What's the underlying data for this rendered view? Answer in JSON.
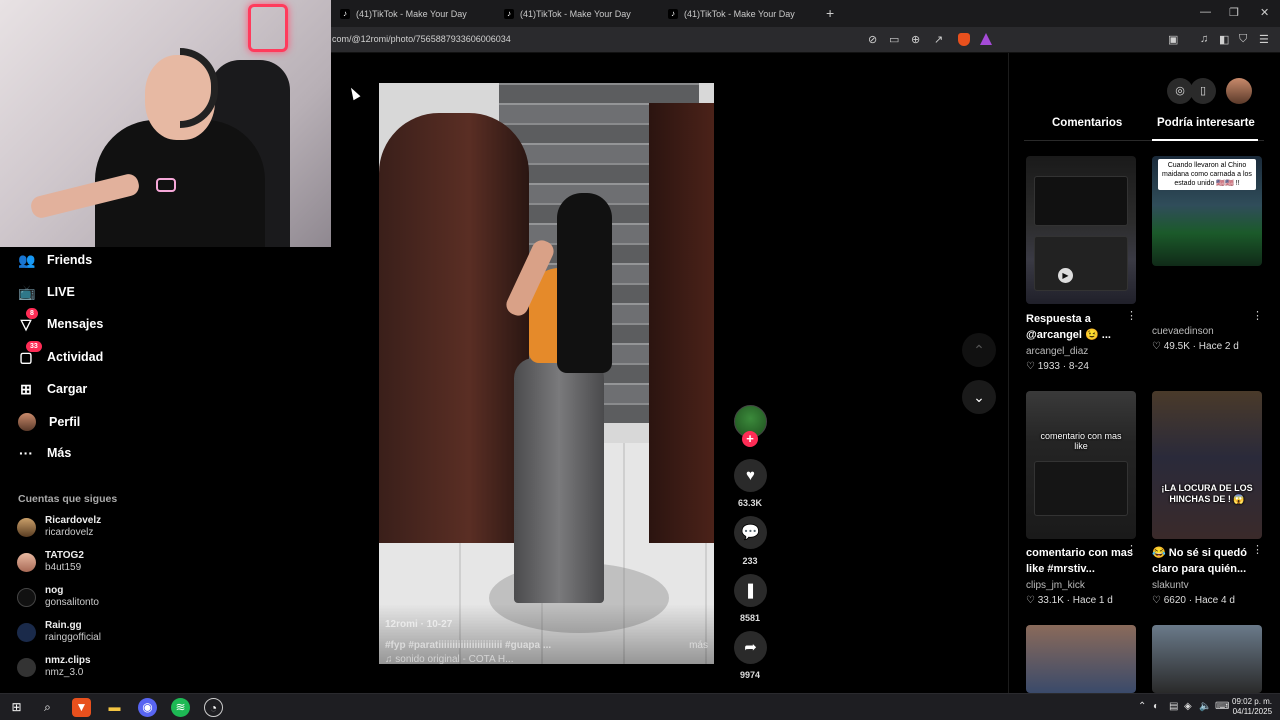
{
  "browser": {
    "tabs": [
      "(41)TikTok - Make Your Day",
      "(41)TikTok - Make Your Day",
      "(41)TikTok - Make Your Day"
    ],
    "url": "com/@12romi/photo/7565887933606006034"
  },
  "nav": {
    "items": [
      "Friends",
      "LIVE",
      "Mensajes",
      "Actividad",
      "Cargar",
      "Perfil",
      "Más"
    ],
    "mensajes_badge": "8",
    "actividad_badge": "33",
    "following_title": "Cuentas que sigues",
    "following": [
      {
        "name": "Ricardovelz",
        "handle": "ricardovelz"
      },
      {
        "name": "TATOG2",
        "handle": "b4ut159"
      },
      {
        "name": "nog",
        "handle": "gonsalitonto"
      },
      {
        "name": "Rain.gg",
        "handle": "rainggofficial"
      },
      {
        "name": "nmz.clips",
        "handle": "nmz_3.0"
      }
    ]
  },
  "post": {
    "author": "12romi · 10-27",
    "caption": "#fyp #paratiiiiiiiiiiiiiiiiiiiiiii #guapa ...",
    "more": "más",
    "sound": "♫ sonido original - COTA H...",
    "likes": "63.3K",
    "comments": "233",
    "saves": "8581",
    "shares": "9974"
  },
  "panel": {
    "tab_comments": "Comentarios",
    "tab_recommended": "Podría interesarte",
    "cards": [
      {
        "thumb_text": "",
        "title": "Respuesta a @arcangel 😉 ...",
        "user": "arcangel_diaz",
        "likes": "1933",
        "when": "8-24"
      },
      {
        "thumb_text": "Cuando llevaron al Chino maidana como carnada a los estado unido 🇺🇸🇺🇸 !!",
        "title": "",
        "user": "cuevaedinson",
        "likes": "49.5K",
        "when": "Hace 2 d"
      },
      {
        "thumb_text": "comentario con mas like",
        "title": "comentario con mas like #mrstiv...",
        "user": "clips_jm_kick",
        "likes": "33.1K",
        "when": "Hace 1 d"
      },
      {
        "thumb_text": "¡LA LOCURA DE LOS HINCHAS DE ! 😱",
        "title": "😂 No sé si quedó claro para quién...",
        "user": "slakuntv",
        "likes": "6620",
        "when": "Hace 4 d"
      }
    ]
  },
  "taskbar": {
    "time": "09:02 p. m.",
    "date": "04/11/2025"
  },
  "colors": {
    "accent": "#fe2c55",
    "orange": "#e58a2a"
  }
}
